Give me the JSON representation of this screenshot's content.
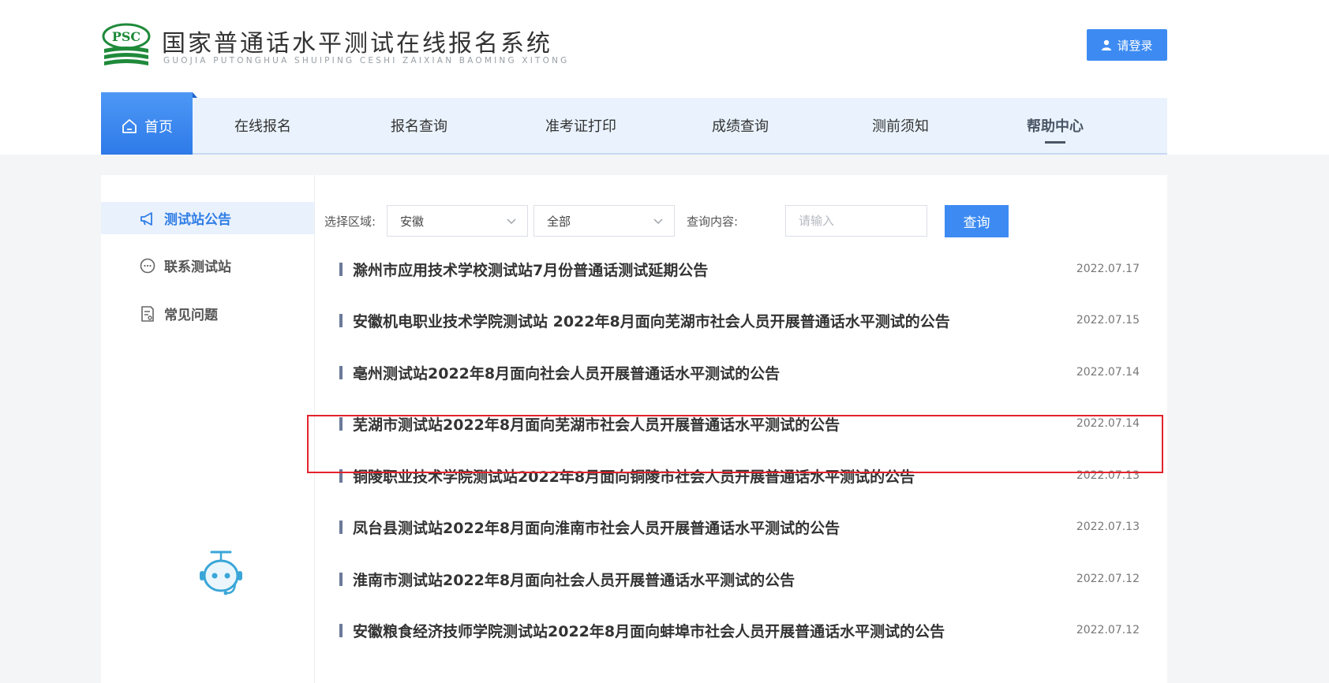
{
  "header": {
    "logo_text": "PSC",
    "title": "国家普通话水平测试在线报名系统",
    "subtitle": "GUOJIA PUTONGHUA SHUIPING CESHI ZAIXIAN BAOMING XITONG",
    "login_label": "请登录"
  },
  "nav": {
    "items": [
      {
        "label": "首页"
      },
      {
        "label": "在线报名"
      },
      {
        "label": "报名查询"
      },
      {
        "label": "准考证打印"
      },
      {
        "label": "成绩查询"
      },
      {
        "label": "测前须知"
      },
      {
        "label": "帮助中心"
      }
    ]
  },
  "sidebar": {
    "items": [
      {
        "label": "测试站公告",
        "icon": "megaphone-icon"
      },
      {
        "label": "联系测试站",
        "icon": "chat-icon"
      },
      {
        "label": "常见问题",
        "icon": "document-icon"
      }
    ]
  },
  "filters": {
    "region_label": "选择区域:",
    "region_value": "安徽",
    "scope_value": "全部",
    "query_label": "查询内容:",
    "query_placeholder": "请输入",
    "query_button": "查询"
  },
  "announcements": [
    {
      "title": "滁州市应用技术学校测试站7月份普通话测试延期公告",
      "date": "2022.07.17"
    },
    {
      "title": "安徽机电职业技术学院测试站 2022年8月面向芜湖市社会人员开展普通话水平测试的公告",
      "date": "2022.07.15"
    },
    {
      "title": "亳州测试站2022年8月面向社会人员开展普通话水平测试的公告",
      "date": "2022.07.14"
    },
    {
      "title": "芜湖市测试站2022年8月面向芜湖市社会人员开展普通话水平测试的公告",
      "date": "2022.07.14"
    },
    {
      "title": "铜陵职业技术学院测试站2022年8月面向铜陵市社会人员开展普通话水平测试的公告",
      "date": "2022.07.13"
    },
    {
      "title": "凤台县测试站2022年8月面向淮南市社会人员开展普通话水平测试的公告",
      "date": "2022.07.13"
    },
    {
      "title": "淮南市测试站2022年8月面向社会人员开展普通话水平测试的公告",
      "date": "2022.07.12"
    },
    {
      "title": "安徽粮食经济技师学院测试站2022年8月面向蚌埠市社会人员开展普通话水平测试的公告",
      "date": "2022.07.12"
    }
  ],
  "colors": {
    "accent": "#3d8bf2",
    "nav_bg": "#eaf3fd",
    "logo_green": "#1f8a3a",
    "highlight": "#e3232c"
  }
}
